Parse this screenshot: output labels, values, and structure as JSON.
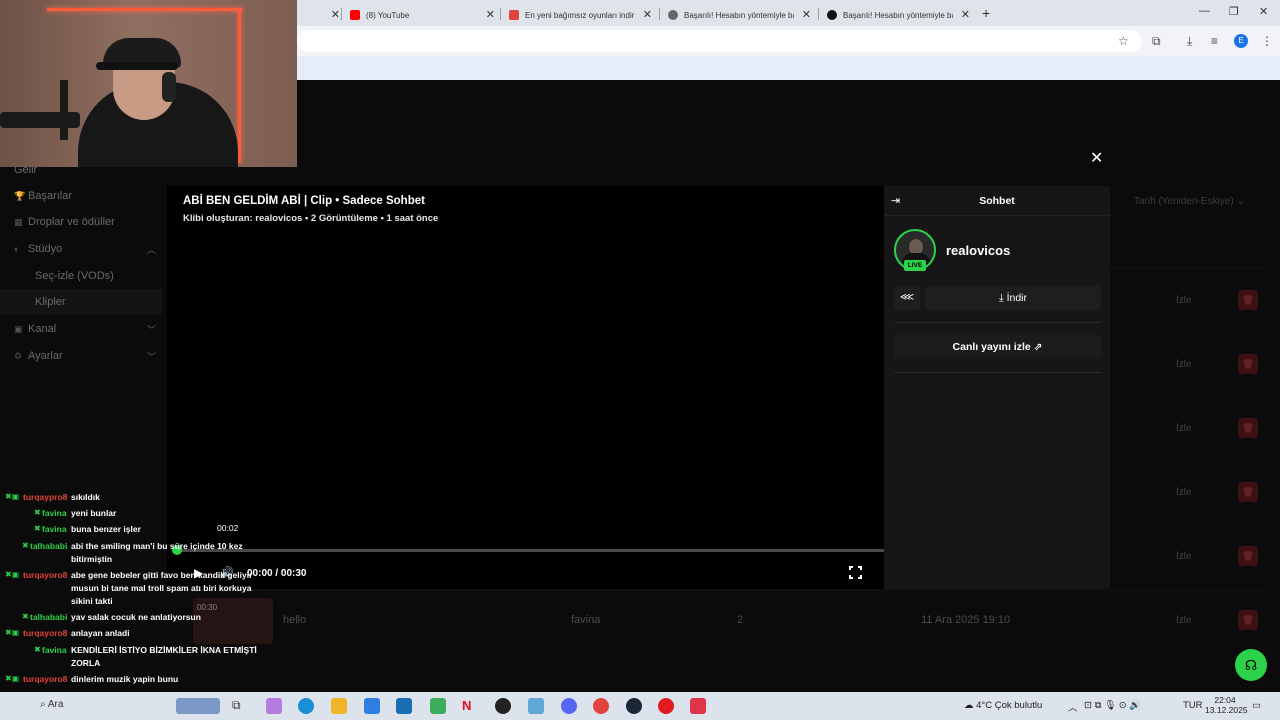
{
  "browser": {
    "tabs": [
      {
        "label": "(8) YouTube",
        "color": "#ff0000"
      },
      {
        "label": "En yeni bağımsız oyunları indir",
        "color": "#e0443c"
      },
      {
        "label": "Başarılı! Hesabın yöntemiyle bağ",
        "color": "#444444"
      },
      {
        "label": "Başarılı! Hesabın yöntemiyle bağ",
        "color": "#111111"
      }
    ],
    "new_tab": "+",
    "profile_initial": "E"
  },
  "sidebar": {
    "items": [
      {
        "label": "Gelir"
      },
      {
        "label": "Başarılar"
      },
      {
        "label": "Droplar ve ödüller"
      },
      {
        "label": "Stüdyo"
      },
      {
        "label": "Seç-izle (VODs)"
      },
      {
        "label": "Klipler"
      },
      {
        "label": "Kanal"
      },
      {
        "label": "Ayarlar"
      }
    ]
  },
  "background_table": {
    "sort_label": "Tarih (Yeniden-Eskiye)",
    "action_label": "İzle",
    "row": {
      "duration": "00:30",
      "title": "hello",
      "creator": "favina",
      "views": "2",
      "date": "11 Ara 2025 19:10"
    }
  },
  "clip": {
    "title": "ABİ BEN GELDİM ABİ | Clip • Sadece Sohbet",
    "meta": "Klibi oluşturan: realovicos • 2 Görüntüleme • 1 saat önce",
    "hover_time": "00:02",
    "time_display": "00:00 / 00:30",
    "progress_fraction": 0.0
  },
  "chat_panel": {
    "title": "Sohbet",
    "streamer": "realovicos",
    "live_badge": "LIVE",
    "download_label": "İndir",
    "watch_live_label": "Canlı yayını izle"
  },
  "overlay_chat": [
    {
      "user": "turqaypro8",
      "color": "#e0443c",
      "badge": "mod",
      "text": "sıkıldık"
    },
    {
      "user": "favina",
      "color": "#2bd24a",
      "badge": "sub",
      "text": "yeni bunlar"
    },
    {
      "user": "favina",
      "color": "#2bd24a",
      "badge": "sub",
      "text": "buna benzer işler"
    },
    {
      "user": "talhababi",
      "color": "#2bd24a",
      "badge": "sub",
      "text": "abi the smiling man'i bu süre içinde 10 kez",
      "text2": "bitirmiştin"
    },
    {
      "user": "turqayoro8",
      "color": "#e0443c",
      "badge": "mod",
      "text": "abe gene bebeler gitti favo ben kandik geliyir",
      "text2": "musun bi tane mal troll spam atı biri korkuya",
      "text3": "sikini takti"
    },
    {
      "user": "talhababi",
      "color": "#2bd24a",
      "badge": "sub",
      "text": "yav salak cocuk ne anlatiyorsun"
    },
    {
      "user": "turqayoro8",
      "color": "#e0443c",
      "badge": "mod",
      "text": "anlayan anladi"
    },
    {
      "user": "favina",
      "color": "#2bd24a",
      "badge": "sub",
      "text": "KENDİLERİ İSTİYO BİZİMKİLER İKNA ETMİŞTİ",
      "text2": "ZORLA"
    },
    {
      "user": "turqayoro8",
      "color": "#e0443c",
      "badge": "mod",
      "text": "dinlerim muzik yapin bunu"
    }
  ],
  "taskbar": {
    "search": "Ara",
    "weather": "4°C  Çok bulutlu",
    "lang": "TUR",
    "time": "22:04",
    "date": "13.12.2025"
  }
}
